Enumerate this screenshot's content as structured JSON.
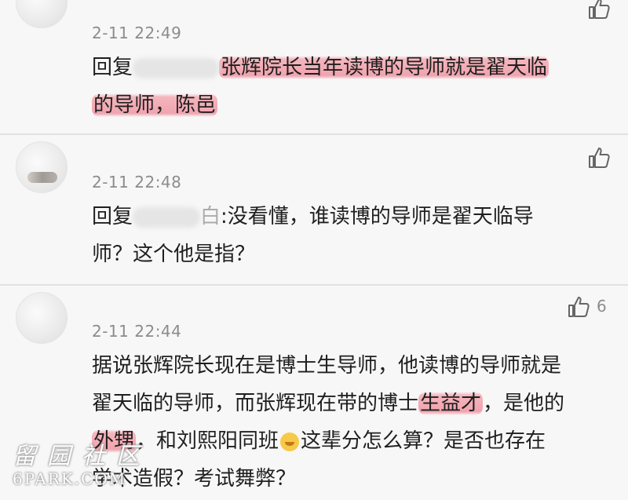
{
  "comments": [
    {
      "time": "2-11 22:49",
      "reply_prefix": "回复",
      "text_hl1": "张辉院长当年读博的导师就是翟天临",
      "text_hl2": "的导师，陈邑",
      "like_count": ""
    },
    {
      "time": "2-11 22:48",
      "reply_prefix": "回复",
      "name_tail": "白",
      "line1_rest": ":没看懂，谁读博的导师是翟天临导",
      "line2": "师？这个他是指？",
      "like_count": ""
    },
    {
      "time": "2-11 22:44",
      "line1": "据说张辉院长现在是博士生导师，他读博的导师就是",
      "line2_a": "翟天临的导师，而张辉现在带的博士",
      "line2_hl": "生益才",
      "line2_b": "，是他的",
      "line3_hl": "外甥",
      "line3_b": "，和刘熙阳同班",
      "line3_c": "这辈分怎么算？是否也存在",
      "line4": "学术造假？考试舞弊？",
      "like_count": "6"
    }
  ],
  "icons": {
    "like": "thumbs-up-icon",
    "emoji": "grinning-face-emoji"
  },
  "watermark": {
    "cn": "留园社区",
    "en": "6PARK.COM"
  },
  "colors": {
    "background": "#f7f7f7",
    "highlight": "#ee8c9b",
    "meta_text": "#8c8c8c"
  }
}
